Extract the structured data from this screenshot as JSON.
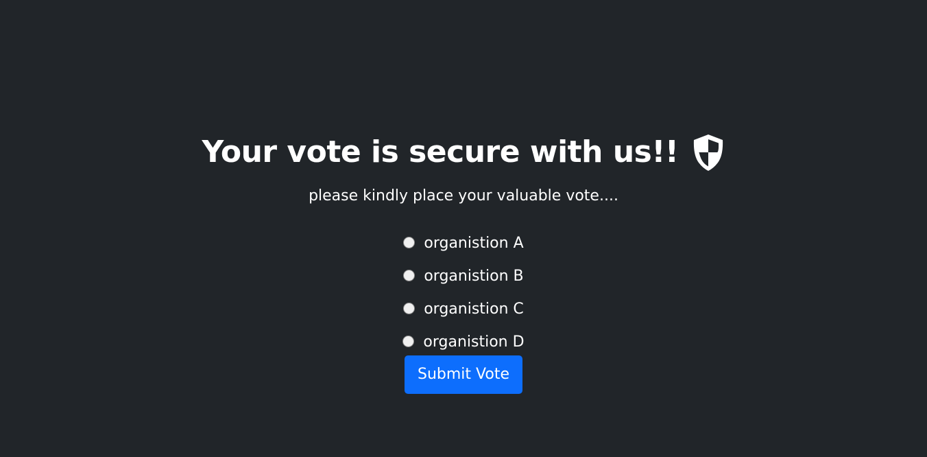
{
  "heading": {
    "title": "Your vote is secure with us!!",
    "icon": "shield-half-icon"
  },
  "subtitle": "please kindly place your valuable vote....",
  "options": [
    {
      "label": "organistion A",
      "selected": false
    },
    {
      "label": "organistion B",
      "selected": false
    },
    {
      "label": "organistion C",
      "selected": false
    },
    {
      "label": "organistion D",
      "selected": false
    }
  ],
  "submit_label": "Submit Vote",
  "colors": {
    "background": "#212529",
    "text": "#ffffff",
    "primary_button": "#0d6efd"
  }
}
